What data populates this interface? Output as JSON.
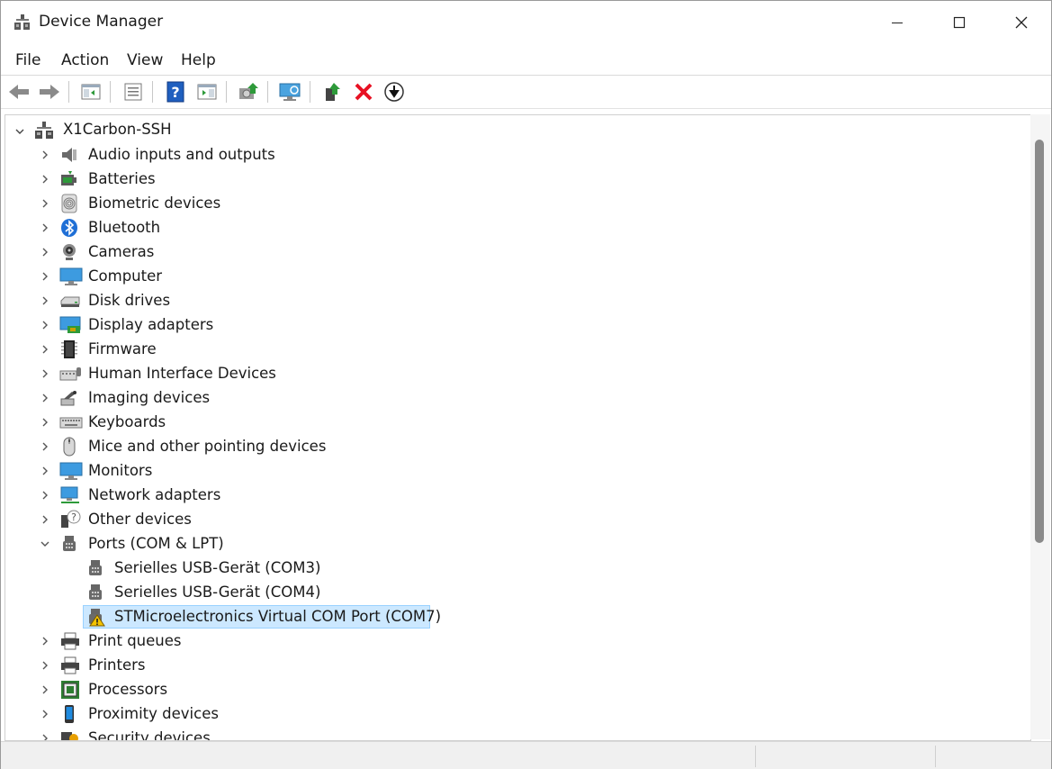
{
  "window": {
    "title": "Device Manager",
    "icons": [
      "device-manager-icon",
      "minimize-icon",
      "maximize-icon",
      "close-icon"
    ]
  },
  "menu": {
    "file": "File",
    "action": "Action",
    "view": "View",
    "help": "Help"
  },
  "toolbar": {
    "buttons": [
      "back-arrow-icon",
      "forward-arrow-icon",
      "show-hide-console-tree-icon",
      "properties-icon",
      "help-icon",
      "action-pane-icon",
      "update-driver-icon",
      "scan-hardware-icon",
      "enable-device-icon",
      "uninstall-device-icon",
      "disable-device-icon"
    ],
    "colors": {
      "green": "#2e9a3a",
      "red": "#e81123",
      "blue": "#1f5fbf"
    }
  },
  "tree": {
    "root": "X1Carbon-SSH",
    "categories": [
      {
        "label": "Audio inputs and outputs",
        "icon": "speaker-icon"
      },
      {
        "label": "Batteries",
        "icon": "battery-icon"
      },
      {
        "label": "Biometric devices",
        "icon": "fingerprint-icon"
      },
      {
        "label": "Bluetooth",
        "icon": "bluetooth-icon"
      },
      {
        "label": "Cameras",
        "icon": "webcam-icon"
      },
      {
        "label": "Computer",
        "icon": "monitor-icon"
      },
      {
        "label": "Disk drives",
        "icon": "disk-drive-icon"
      },
      {
        "label": "Display adapters",
        "icon": "display-adapter-icon"
      },
      {
        "label": "Firmware",
        "icon": "chip-icon"
      },
      {
        "label": "Human Interface Devices",
        "icon": "hid-icon"
      },
      {
        "label": "Imaging devices",
        "icon": "scanner-icon"
      },
      {
        "label": "Keyboards",
        "icon": "keyboard-icon"
      },
      {
        "label": "Mice and other pointing devices",
        "icon": "mouse-icon"
      },
      {
        "label": "Monitors",
        "icon": "monitor-icon"
      },
      {
        "label": "Network adapters",
        "icon": "network-icon"
      },
      {
        "label": "Other devices",
        "icon": "unknown-device-icon"
      },
      {
        "label": "Ports (COM & LPT)",
        "icon": "port-icon",
        "expanded": true
      },
      {
        "label": "Print queues",
        "icon": "printer-icon"
      },
      {
        "label": "Printers",
        "icon": "printer-icon"
      },
      {
        "label": "Processors",
        "icon": "processor-icon"
      },
      {
        "label": "Proximity devices",
        "icon": "phone-icon"
      },
      {
        "label": "Security devices",
        "icon": "security-icon"
      }
    ],
    "ports_children": [
      {
        "label": "Serielles USB-Gerät (COM3)",
        "icon": "port-icon",
        "warning": false
      },
      {
        "label": "Serielles USB-Gerät (COM4)",
        "icon": "port-icon",
        "warning": false
      },
      {
        "label": "STMicroelectronics Virtual COM Port (COM7)",
        "icon": "port-icon",
        "warning": true,
        "selected": true
      }
    ],
    "selection_color": "#cce8ff"
  }
}
